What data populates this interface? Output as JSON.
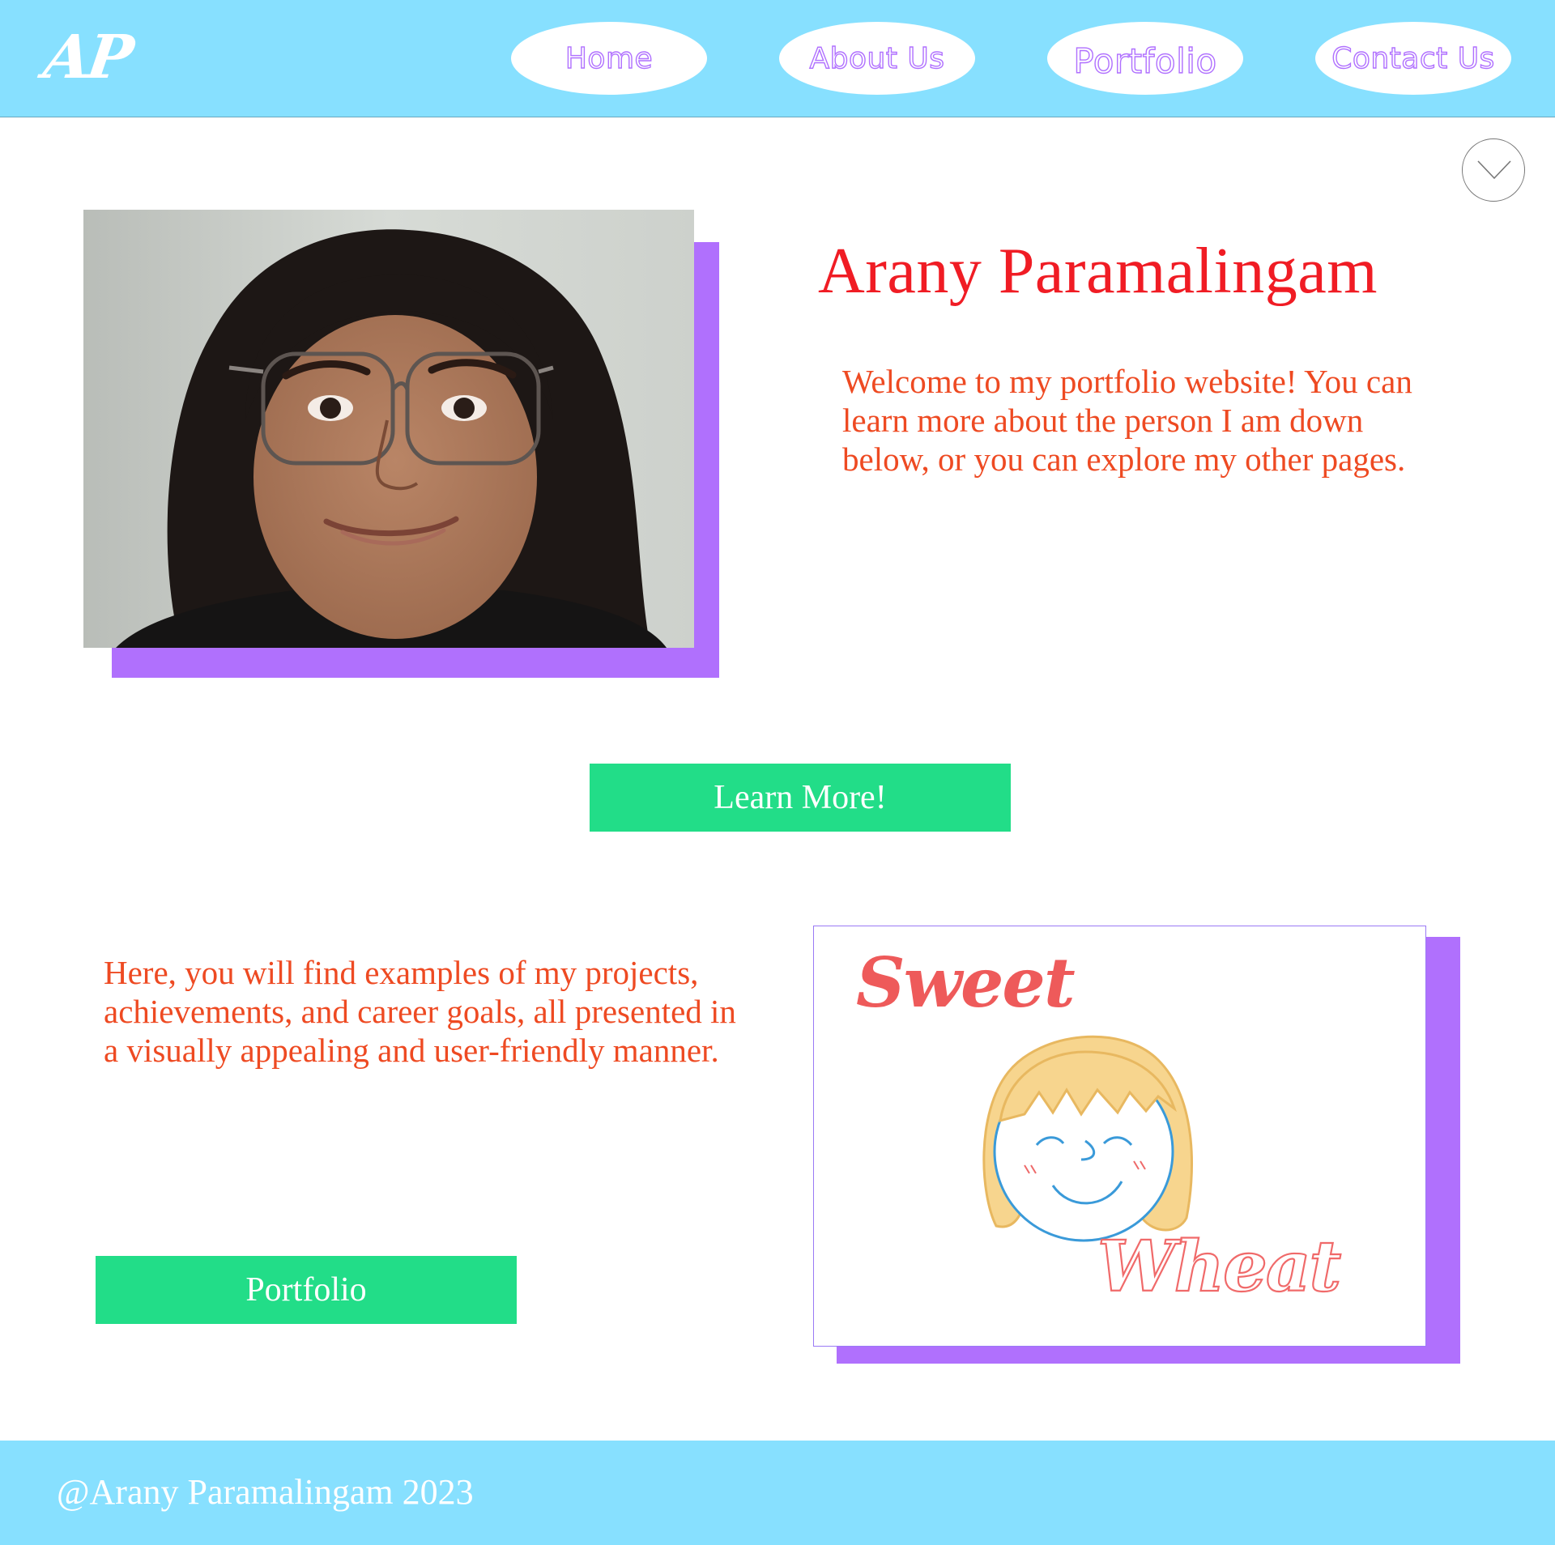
{
  "header": {
    "logo": "AP",
    "nav": [
      {
        "label": "Home"
      },
      {
        "label": "About Us"
      },
      {
        "label": "Portfolio"
      },
      {
        "label": "Contact Us"
      }
    ]
  },
  "hero": {
    "name": "Arany Paramalingam",
    "intro": "Welcome to my portfolio website! You can learn more about the person I am down below, or you can explore my other pages.",
    "cta_label": "Learn More!"
  },
  "portfolio_section": {
    "text": "Here, you will find examples of my projects, achievements, and career goals, all presented in a visually appealing and user-friendly manner.",
    "button_label": "Portfolio",
    "card": {
      "title_top": "Sweet",
      "title_bottom": "Wheat"
    }
  },
  "footer": {
    "copyright": "@Arany Paramalingam 2023"
  },
  "colors": {
    "header_bg": "#87e0ff",
    "nav_text": "#b070ff",
    "accent_purple": "#b070fd",
    "name_red": "#f01c24",
    "body_text": "#ee4a22",
    "button_green": "#22dd88"
  },
  "icons": {
    "scroll": "chevron-down-icon"
  }
}
